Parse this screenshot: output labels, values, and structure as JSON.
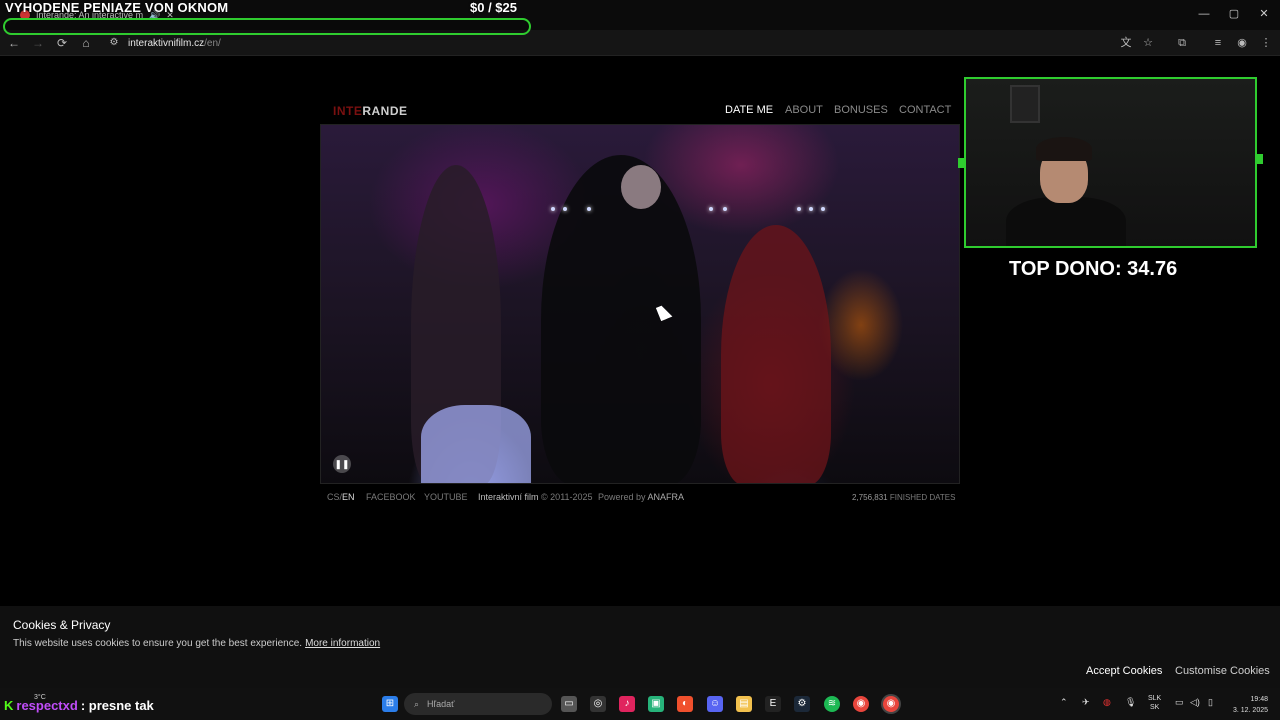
{
  "browser": {
    "tab_title": "Interande: An interactive m",
    "url_domain": "interaktivnifilm.cz",
    "url_path": "/en/",
    "window_controls": [
      "—",
      "▢",
      "✕"
    ]
  },
  "overlay": {
    "title": "VYHODENE PENIAZE VON OKNOM",
    "goal": "$0   / $25",
    "goal_progress": 0,
    "top_dono": "TOP DONO: 34.76",
    "accent_color": "#2fcc2f"
  },
  "site": {
    "logo_red": "INTE",
    "logo_white": "RANDE",
    "nav": [
      "DATE ME",
      "ABOUT",
      "BONUSES",
      "CONTACT"
    ],
    "footer": {
      "lang_cs": "CS",
      "lang_sep": "/",
      "lang_en": "EN",
      "facebook": "FACEBOOK",
      "youtube": "YOUTUBE",
      "copyright_name": "Interaktivní film",
      "copyright_years": "© 2011-2025",
      "powered_label": "Powered by",
      "powered_name": "ANAFRA",
      "count": "2,756,831",
      "count_label": "FINISHED DATES"
    }
  },
  "cookie": {
    "title": "Cookies & Privacy",
    "text": "This website uses cookies to ensure you get the best experience.",
    "link": "More information",
    "accept": "Accept Cookies",
    "customise": "Customise Cookies"
  },
  "chat": {
    "platform_glyph": "K",
    "user": "respectxd",
    "message": ": presne tak",
    "weather": "3°C"
  },
  "taskbar": {
    "search_placeholder": "Hľadať",
    "lang_top": "SLK",
    "lang_bottom": "SK",
    "time": "19:48",
    "date": "3. 12. 2025"
  }
}
